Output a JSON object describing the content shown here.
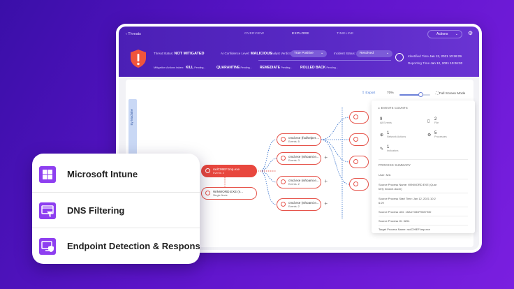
{
  "header": {
    "back_label": "Threats",
    "tabs": [
      {
        "label": "OVERVIEW",
        "active": false
      },
      {
        "label": "EXPLORE",
        "active": true
      },
      {
        "label": "TIMELINE",
        "active": false
      }
    ],
    "actions_label": "Actions",
    "threat_status_label": "Threat Status:",
    "threat_status_value": "NOT MITIGATED",
    "ai_confidence_label": "AI Confidence Level:",
    "ai_confidence_value": "MALICIOUS",
    "analyst_verdict_label": "Analyst Verdict:",
    "analyst_verdict_value": "True Positive",
    "incident_status_label": "Incident Status:",
    "incident_status_value": "Resolved",
    "mitigation_label": "Mitigation Actions taken:",
    "mitigations": [
      {
        "name": "KILL",
        "status": "Pending..."
      },
      {
        "name": "QUARANTINE",
        "status": "Pending..."
      },
      {
        "name": "REMEDIATE",
        "status": "Pending..."
      },
      {
        "name": "ROLLED BACK",
        "status": "Pending..."
      }
    ],
    "identified_time_label": "Identified Time",
    "identified_time_value": "Jan 12, 2021 10:26:29",
    "reporting_time_label": "Reporting Time",
    "reporting_time_value": "Jan 12, 2021 10:26:30"
  },
  "toolbar": {
    "side_tab_label": "By Machine",
    "export_label": "Export",
    "zoom_level": "70%",
    "zoom_fraction": 0.7,
    "fullscreen_label": "Full Screen Mode"
  },
  "graph": {
    "main_node": {
      "name": "radC99EF.tmp.exe",
      "sub": "Events: 4"
    },
    "parent_node": {
      "name": "WINWORD.EXE (n...",
      "sub": "Single Node"
    },
    "children": [
      {
        "name": "cmd.exe (fodhelper....",
        "sub": "Events: 5"
      },
      {
        "name": "cmd.exe (whoami.e...",
        "sub": "Events: 3"
      },
      {
        "name": "cmd.exe (whoami.e...",
        "sub": "Events: 2"
      },
      {
        "name": "cmd.exe (whoami.e...",
        "sub": "Events: 2"
      }
    ]
  },
  "panel": {
    "events_title": "EVENTS COUNTS",
    "stats": [
      {
        "value": "9",
        "label": "All Events"
      },
      {
        "value": "2",
        "label": "File"
      },
      {
        "value": "1",
        "label": "Network Actions"
      },
      {
        "value": "5",
        "label": "Processes"
      },
      {
        "value": "1",
        "label": "Indicators"
      }
    ],
    "summary_title": "PROCESS SUMMARY",
    "lines": [
      "User: N/A",
      "Source Process Name: WINWORD.EXE (Quar",
      "terly Invoice.docm)",
      "Source Process Start Time: Jan 12, 2021 10:2",
      "6:29",
      "Source Process UID: 15AD7333F9087930",
      "Source Process ID: 3204",
      "Target Process Name: radC99EF.tmp.exe"
    ]
  },
  "features": [
    {
      "label": "Microsoft Intune",
      "icon": "windows-grid-icon"
    },
    {
      "label": "DNS Filtering",
      "icon": "dns-filter-icon"
    },
    {
      "label": "Endpoint Detection & Response",
      "icon": "shield-monitor-icon"
    }
  ],
  "colors": {
    "background": "#5c14c9",
    "header": "#4b1fb5",
    "threat_red": "#e8473e",
    "feature_icon": "#8e3ff0"
  }
}
